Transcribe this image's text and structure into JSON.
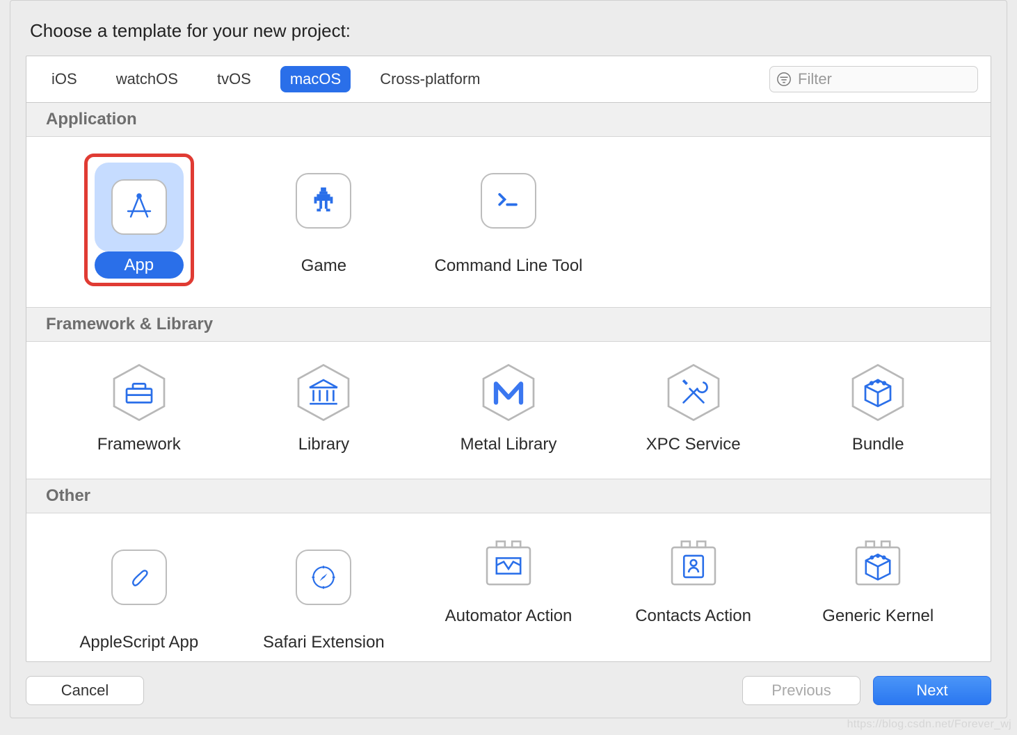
{
  "title": "Choose a template for your new project:",
  "tabs": [
    "iOS",
    "watchOS",
    "tvOS",
    "macOS",
    "Cross-platform"
  ],
  "active_tab_index": 3,
  "filter": {
    "placeholder": "Filter",
    "value": ""
  },
  "sections": {
    "application": {
      "header": "Application",
      "items": [
        {
          "label": "App",
          "selected": true,
          "highlighted": true,
          "icon": "app-store-icon"
        },
        {
          "label": "Game",
          "icon": "game-sprite-icon"
        },
        {
          "label": "Command Line Tool",
          "icon": "terminal-icon"
        }
      ]
    },
    "framework_library": {
      "header": "Framework & Library",
      "items": [
        {
          "label": "Framework",
          "icon": "toolbox-icon"
        },
        {
          "label": "Library",
          "icon": "library-building-icon"
        },
        {
          "label": "Metal Library",
          "icon": "metal-m-icon"
        },
        {
          "label": "XPC Service",
          "icon": "tools-icon"
        },
        {
          "label": "Bundle",
          "icon": "cube-icon"
        }
      ]
    },
    "other": {
      "header": "Other",
      "items": [
        {
          "label": "AppleScript App",
          "icon": "script-icon"
        },
        {
          "label": "Safari Extension",
          "icon": "safari-compass-icon"
        },
        {
          "label": "Automator Action",
          "icon": "automator-action-icon"
        },
        {
          "label": "Contacts Action",
          "icon": "contacts-action-icon"
        },
        {
          "label": "Generic Kernel",
          "icon": "kernel-cube-icon"
        }
      ]
    }
  },
  "buttons": {
    "cancel": "Cancel",
    "previous": "Previous",
    "next": "Next"
  },
  "watermark": "https://blog.csdn.net/Forever_wj",
  "colors": {
    "accent": "#2a6fe9",
    "highlight_border": "#e03b33",
    "selected_bg": "#c6dcff"
  }
}
